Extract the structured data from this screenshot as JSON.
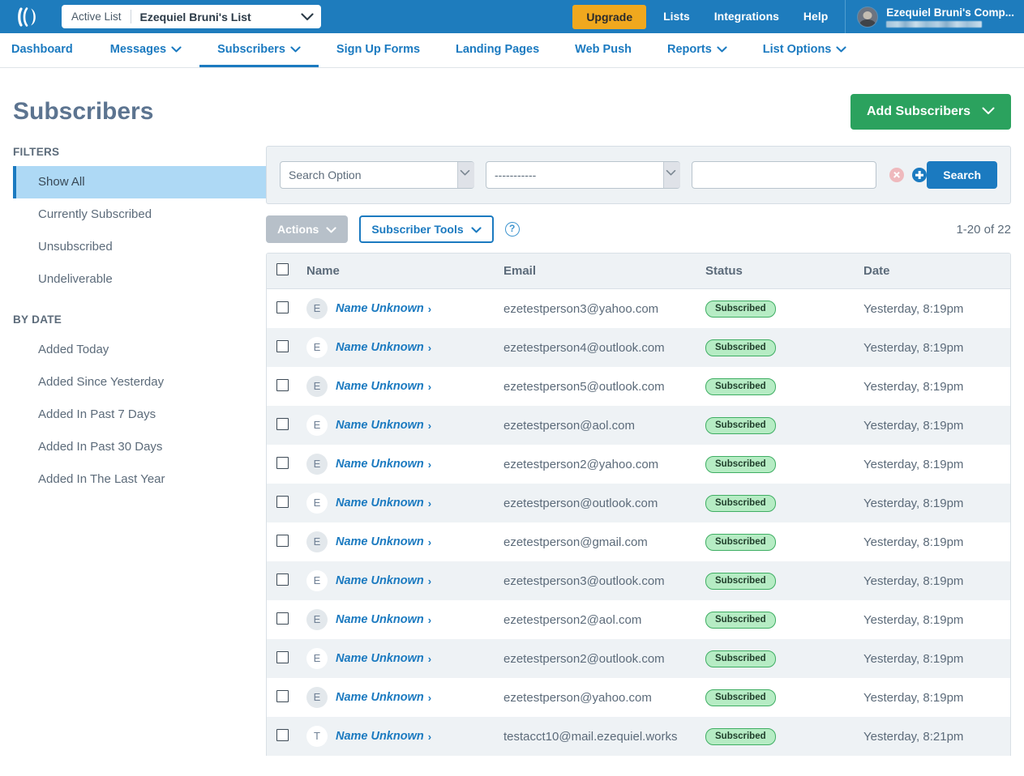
{
  "topbar": {
    "logo_icon": "aweber-logo-icon",
    "list_label": "Active List",
    "list_value": "Ezequiel Bruni's List",
    "caret_icon": "chevron-down-icon",
    "upgrade_label": "Upgrade",
    "links": [
      {
        "label": "Lists"
      },
      {
        "label": "Integrations"
      },
      {
        "label": "Help"
      }
    ],
    "account_name": "Ezequiel Bruni's Comp...",
    "account_sub_redacted": "",
    "avatar_icon": "avatar-photo-icon",
    "brand_blue": "#1e7cbd",
    "upgrade_orange": "#f0a81e"
  },
  "nav": {
    "items": [
      {
        "label": "Dashboard",
        "has_caret": false,
        "active": false
      },
      {
        "label": "Messages",
        "has_caret": true,
        "active": false
      },
      {
        "label": "Subscribers",
        "has_caret": true,
        "active": true
      },
      {
        "label": "Sign Up Forms",
        "has_caret": false,
        "active": false
      },
      {
        "label": "Landing Pages",
        "has_caret": false,
        "active": false
      },
      {
        "label": "Web Push",
        "has_caret": false,
        "active": false
      },
      {
        "label": "Reports",
        "has_caret": true,
        "active": false
      },
      {
        "label": "List Options",
        "has_caret": true,
        "active": false
      }
    ],
    "link_color": "#1b7ac0"
  },
  "page": {
    "title": "Subscribers",
    "add_subscribers_label": "Add Subscribers",
    "add_subscribers_caret": "chevron-down-icon",
    "green": "#2ba25e"
  },
  "sidebar": {
    "filters_heading": "FILTERS",
    "filters": [
      {
        "label": "Show All",
        "active": true
      },
      {
        "label": "Currently Subscribed",
        "active": false
      },
      {
        "label": "Unsubscribed",
        "active": false
      },
      {
        "label": "Undeliverable",
        "active": false
      }
    ],
    "bydate_heading": "BY DATE",
    "bydate": [
      {
        "label": "Added Today"
      },
      {
        "label": "Added Since Yesterday"
      },
      {
        "label": "Added In Past 7 Days"
      },
      {
        "label": "Added In Past 30 Days"
      },
      {
        "label": "Added In The Last Year"
      }
    ]
  },
  "search": {
    "option_selected": "Search Option",
    "option_items": [
      "Search Option"
    ],
    "field_selected": "-----------",
    "field_items": [
      "-----------"
    ],
    "value": "",
    "value_placeholder": "",
    "clear_icon": "clear-circle-x-icon",
    "add_icon": "add-circle-plus-icon",
    "search_label": "Search"
  },
  "toolbar": {
    "actions_label": "Actions",
    "actions_caret": "chevron-down-icon",
    "tools_label": "Subscriber Tools",
    "tools_caret": "chevron-down-icon",
    "help_icon": "question-mark-circle-icon",
    "help_glyph": "?",
    "pager_text": "1-20 of 22"
  },
  "table": {
    "columns": [
      "Name",
      "Email",
      "Status",
      "Date"
    ],
    "select_all_icon": "checkbox-unchecked-icon",
    "rows": [
      {
        "avatar": "E",
        "name": "Name Unknown",
        "email": "ezetestperson3@yahoo.com",
        "status": "Subscribed",
        "date": "Yesterday, 8:19pm"
      },
      {
        "avatar": "E",
        "name": "Name Unknown",
        "email": "ezetestperson4@outlook.com",
        "status": "Subscribed",
        "date": "Yesterday, 8:19pm"
      },
      {
        "avatar": "E",
        "name": "Name Unknown",
        "email": "ezetestperson5@outlook.com",
        "status": "Subscribed",
        "date": "Yesterday, 8:19pm"
      },
      {
        "avatar": "E",
        "name": "Name Unknown",
        "email": "ezetestperson@aol.com",
        "status": "Subscribed",
        "date": "Yesterday, 8:19pm"
      },
      {
        "avatar": "E",
        "name": "Name Unknown",
        "email": "ezetestperson2@yahoo.com",
        "status": "Subscribed",
        "date": "Yesterday, 8:19pm"
      },
      {
        "avatar": "E",
        "name": "Name Unknown",
        "email": "ezetestperson@outlook.com",
        "status": "Subscribed",
        "date": "Yesterday, 8:19pm"
      },
      {
        "avatar": "E",
        "name": "Name Unknown",
        "email": "ezetestperson@gmail.com",
        "status": "Subscribed",
        "date": "Yesterday, 8:19pm"
      },
      {
        "avatar": "E",
        "name": "Name Unknown",
        "email": "ezetestperson3@outlook.com",
        "status": "Subscribed",
        "date": "Yesterday, 8:19pm"
      },
      {
        "avatar": "E",
        "name": "Name Unknown",
        "email": "ezetestperson2@aol.com",
        "status": "Subscribed",
        "date": "Yesterday, 8:19pm"
      },
      {
        "avatar": "E",
        "name": "Name Unknown",
        "email": "ezetestperson2@outlook.com",
        "status": "Subscribed",
        "date": "Yesterday, 8:19pm"
      },
      {
        "avatar": "E",
        "name": "Name Unknown",
        "email": "ezetestperson@yahoo.com",
        "status": "Subscribed",
        "date": "Yesterday, 8:19pm"
      },
      {
        "avatar": "T",
        "name": "Name Unknown",
        "email": "testacct10@mail.ezequiel.works",
        "status": "Subscribed",
        "date": "Yesterday, 8:21pm"
      }
    ],
    "row_chevron_icon": "chevron-right-icon",
    "status_badge_color": "#b6ecc4"
  }
}
